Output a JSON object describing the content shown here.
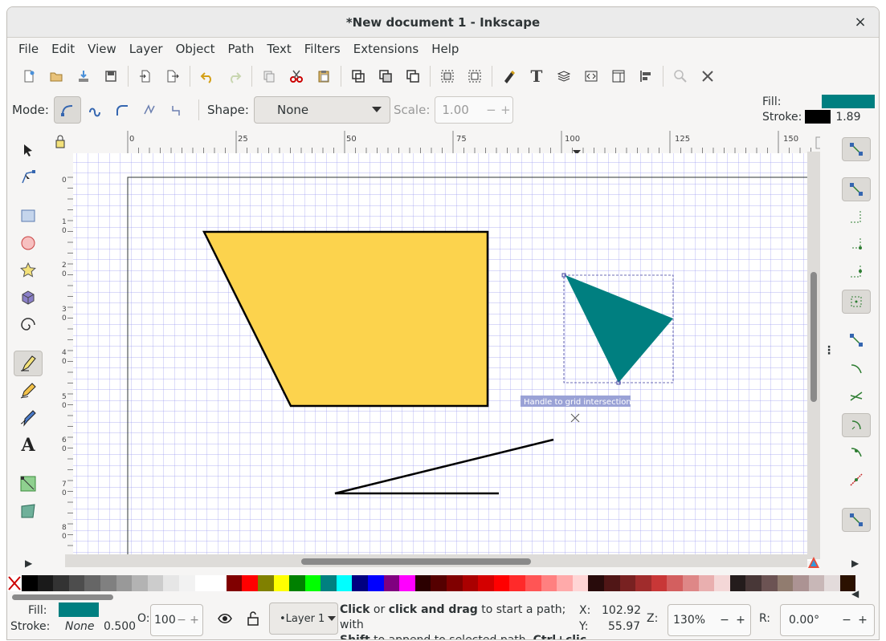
{
  "window": {
    "title": "*New document 1 - Inkscape",
    "close_symbol": "×"
  },
  "menu": [
    "File",
    "Edit",
    "View",
    "Layer",
    "Object",
    "Path",
    "Text",
    "Filters",
    "Extensions",
    "Help"
  ],
  "toolcontrols": {
    "mode_label": "Mode:",
    "shape_label": "Shape:",
    "shape_value": "None",
    "scale_label": "Scale:",
    "scale_value": "1.00"
  },
  "style_indicator": {
    "fill_label": "Fill:",
    "stroke_label": "Stroke:",
    "fill_color": "#007f80",
    "stroke_color": "#000000",
    "stroke_width": "1.89"
  },
  "rulers": {
    "top": [
      "0",
      "25",
      "50",
      "75",
      "100",
      "125",
      "150"
    ],
    "left": [
      "0",
      "1",
      "2",
      "3",
      "4",
      "5",
      "6",
      "7",
      "8"
    ],
    "left_sub": [
      "",
      "0",
      "0",
      "0",
      "0",
      "0",
      "0",
      "0",
      "0"
    ]
  },
  "canvas": {
    "snap_tooltip": "Handle to grid intersection",
    "quad_fill": "#fcd34d",
    "triangle_fill": "#007f80"
  },
  "palette": [
    "#000000",
    "#1a1a1a",
    "#333333",
    "#4d4d4d",
    "#666666",
    "#808080",
    "#999999",
    "#b3b3b3",
    "#cccccc",
    "#e6e6e6",
    "#f2f2f2",
    "#ffffff",
    "#ffffff",
    "#800000",
    "#ff0000",
    "#808000",
    "#ffff00",
    "#008000",
    "#00ff00",
    "#008080",
    "#00ffff",
    "#000080",
    "#0000ff",
    "#800080",
    "#ff00ff",
    "#2b0000",
    "#550000",
    "#800000",
    "#aa0000",
    "#d40000",
    "#ff0000",
    "#ff2a2a",
    "#ff5555",
    "#ff8080",
    "#ffaaaa",
    "#ffd5d5",
    "#280b0b",
    "#501616",
    "#782121",
    "#a02c2c",
    "#c83737",
    "#d35f5f",
    "#de8787",
    "#e9afaf",
    "#f4d7d7",
    "#241c1c",
    "#483737",
    "#6c5353",
    "#917c6f",
    "#ac9393",
    "#c8b7b7",
    "#e3dbdb",
    "#2b1100"
  ],
  "status": {
    "fill_label": "Fill:",
    "stroke_label": "Stroke:",
    "stroke_value": "None",
    "stroke_width": "0.500",
    "fill_color": "#007f80",
    "opacity_label": "O:",
    "opacity_value": "100",
    "layer": "•Layer 1",
    "msg1a": "Click",
    "msg1b": " or ",
    "msg1c": "click and drag",
    "msg1d": " to start a path; with",
    "msg2a": "Shift",
    "msg2b": " to append to selected path. ",
    "msg2c": "Ctrl+clic...",
    "x_label": "X:",
    "x_value": "102.92",
    "y_label": "Y:",
    "y_value": "55.97",
    "z_label": "Z:",
    "zoom": "130%",
    "r_label": "R:",
    "rotation": "0.00°"
  }
}
